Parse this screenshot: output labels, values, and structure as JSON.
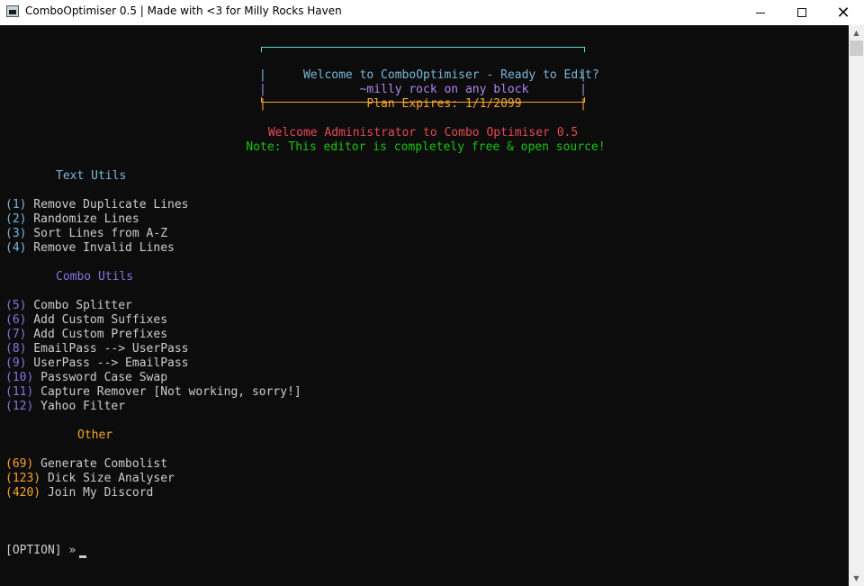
{
  "window": {
    "title": "ComboOptimiser 0.5 | Made with <3 for Milly Rocks Haven",
    "close_glyph": "✕"
  },
  "banner": {
    "line1": "Welcome to ComboOptimiser - Ready to Edit?",
    "line2": "~milly rock on any block",
    "line3": "Plan Expires: 1/1/2099",
    "border_char": "|"
  },
  "welcome": {
    "greeting": "Welcome Administrator to Combo Optimiser 0.5",
    "note": "Note: This editor is completely free & open source!"
  },
  "sections": {
    "text_utils": {
      "heading": "Text Utils",
      "items": [
        {
          "num": "(1)",
          "label": " Remove Duplicate Lines"
        },
        {
          "num": "(2)",
          "label": " Randomize Lines"
        },
        {
          "num": "(3)",
          "label": " Sort Lines from A-Z"
        },
        {
          "num": "(4)",
          "label": " Remove Invalid Lines"
        }
      ]
    },
    "combo_utils": {
      "heading": "Combo Utils",
      "items": [
        {
          "num": "(5)",
          "label": " Combo Splitter"
        },
        {
          "num": "(6)",
          "label": " Add Custom Suffixes"
        },
        {
          "num": "(7)",
          "label": " Add Custom Prefixes"
        },
        {
          "num": "(8)",
          "label": " EmailPass --> UserPass"
        },
        {
          "num": "(9)",
          "label": " UserPass --> EmailPass"
        },
        {
          "num": "(10)",
          "label": " Password Case Swap"
        },
        {
          "num": "(11)",
          "label": " Capture Remover [Not working, sorry!]"
        },
        {
          "num": "(12)",
          "label": " Yahoo Filter"
        }
      ]
    },
    "other": {
      "heading": "Other",
      "items": [
        {
          "num": "(69)",
          "label": " Generate Combolist"
        },
        {
          "num": "(123)",
          "label": " Dick Size Analyser"
        },
        {
          "num": "(420)",
          "label": " Join My Discord"
        }
      ]
    }
  },
  "prompt": {
    "text": "[OPTION] »"
  },
  "colors": {
    "background": "#0c0c0c",
    "text": "#cccccc",
    "cyan": "#61d6d6",
    "purple": "#b083f0",
    "orange": "#f9a52b",
    "red": "#e74856",
    "green": "#16c60c"
  }
}
